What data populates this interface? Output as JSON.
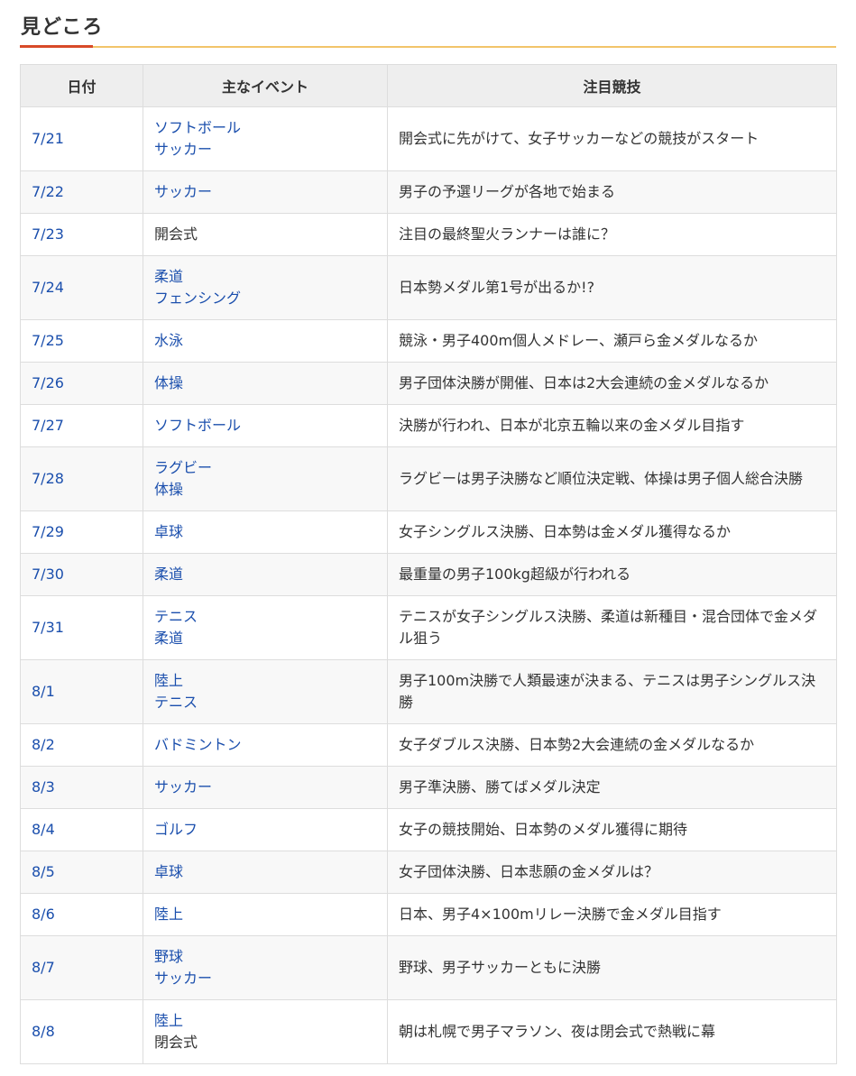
{
  "heading": {
    "title": "見どころ"
  },
  "colors": {
    "link": "#1b4fad",
    "accent_red": "#d84a28",
    "accent_gold": "#f2c46a",
    "header_bg": "#eeeeee"
  },
  "table": {
    "headers": [
      "日付",
      "主なイベント",
      "注目競技"
    ],
    "rows": [
      {
        "date": "7/21",
        "events": [
          "ソフトボール",
          "サッカー"
        ],
        "events_link": [
          true,
          true
        ],
        "highlight": "開会式に先がけて、女子サッカーなどの競技がスタート"
      },
      {
        "date": "7/22",
        "events": [
          "サッカー"
        ],
        "events_link": [
          true
        ],
        "highlight": "男子の予選リーグが各地で始まる"
      },
      {
        "date": "7/23",
        "events": [
          "開会式"
        ],
        "events_link": [
          false
        ],
        "highlight": "注目の最終聖火ランナーは誰に？"
      },
      {
        "date": "7/24",
        "events": [
          "柔道",
          "フェンシング"
        ],
        "events_link": [
          true,
          true
        ],
        "highlight": "日本勢メダル第1号が出るか!?"
      },
      {
        "date": "7/25",
        "events": [
          "水泳"
        ],
        "events_link": [
          true
        ],
        "highlight": "競泳・男子400m個人メドレー、瀬戸ら金メダルなるか"
      },
      {
        "date": "7/26",
        "events": [
          "体操"
        ],
        "events_link": [
          true
        ],
        "highlight": "男子団体決勝が開催、日本は2大会連続の金メダルなるか"
      },
      {
        "date": "7/27",
        "events": [
          "ソフトボール"
        ],
        "events_link": [
          true
        ],
        "highlight": "決勝が行われ、日本が北京五輪以来の金メダル目指す"
      },
      {
        "date": "7/28",
        "events": [
          "ラグビー",
          "体操"
        ],
        "events_link": [
          true,
          true
        ],
        "highlight": "ラグビーは男子決勝など順位決定戦、体操は男子個人総合決勝"
      },
      {
        "date": "7/29",
        "events": [
          "卓球"
        ],
        "events_link": [
          true
        ],
        "highlight": "女子シングルス決勝、日本勢は金メダル獲得なるか"
      },
      {
        "date": "7/30",
        "events": [
          "柔道"
        ],
        "events_link": [
          true
        ],
        "highlight": "最重量の男子100kg超級が行われる"
      },
      {
        "date": "7/31",
        "events": [
          "テニス",
          "柔道"
        ],
        "events_link": [
          true,
          true
        ],
        "highlight": "テニスが女子シングルス決勝、柔道は新種目・混合団体で金メダル狙う"
      },
      {
        "date": "8/1",
        "events": [
          "陸上",
          "テニス"
        ],
        "events_link": [
          true,
          true
        ],
        "highlight": "男子100m決勝で人類最速が決まる、テニスは男子シングルス決勝"
      },
      {
        "date": "8/2",
        "events": [
          "バドミントン"
        ],
        "events_link": [
          true
        ],
        "highlight": "女子ダブルス決勝、日本勢2大会連続の金メダルなるか"
      },
      {
        "date": "8/3",
        "events": [
          "サッカー"
        ],
        "events_link": [
          true
        ],
        "highlight": "男子準決勝、勝てばメダル決定"
      },
      {
        "date": "8/4",
        "events": [
          "ゴルフ"
        ],
        "events_link": [
          true
        ],
        "highlight": "女子の競技開始、日本勢のメダル獲得に期待"
      },
      {
        "date": "8/5",
        "events": [
          "卓球"
        ],
        "events_link": [
          true
        ],
        "highlight": "女子団体決勝、日本悲願の金メダルは？"
      },
      {
        "date": "8/6",
        "events": [
          "陸上"
        ],
        "events_link": [
          true
        ],
        "highlight": "日本、男子4×100mリレー決勝で金メダル目指す"
      },
      {
        "date": "8/7",
        "events": [
          "野球",
          "サッカー"
        ],
        "events_link": [
          true,
          true
        ],
        "highlight": "野球、男子サッカーともに決勝"
      },
      {
        "date": "8/8",
        "events": [
          "陸上",
          "閉会式"
        ],
        "events_link": [
          true,
          false
        ],
        "highlight": "朝は札幌で男子マラソン、夜は閉会式で熱戦に幕"
      }
    ]
  }
}
